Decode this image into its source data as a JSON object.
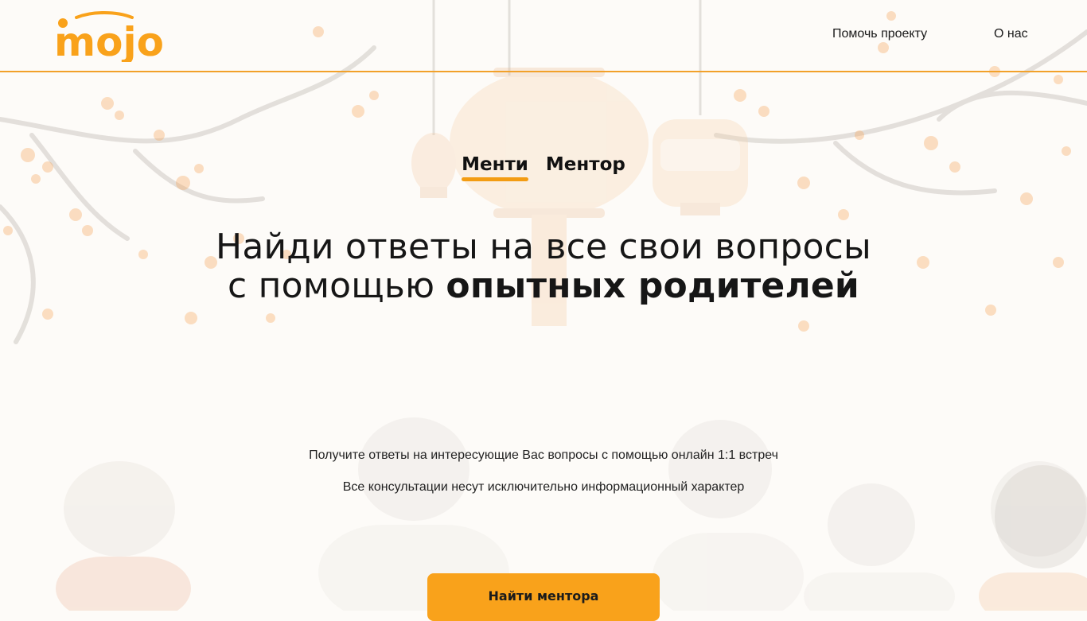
{
  "brand": {
    "logo_text": "mojo",
    "accent_color": "#f9a21b"
  },
  "nav": {
    "help_label": "Помочь проекту",
    "about_label": "О нас"
  },
  "tabs": [
    {
      "label": "Менти",
      "active": true
    },
    {
      "label": "Ментор",
      "active": false
    }
  ],
  "hero": {
    "headline_line1": "Найди ответы на все свои вопросы",
    "headline_line2_regular": "с помощью",
    "headline_line2_bold": "опытных родителей",
    "subtitle1": "Получите ответы на интересующие Вас вопросы с помощью онлайн 1:1 встреч",
    "subtitle2": "Все консультации несут исключительно информационный характер",
    "cta_label": "Найти ментора"
  }
}
